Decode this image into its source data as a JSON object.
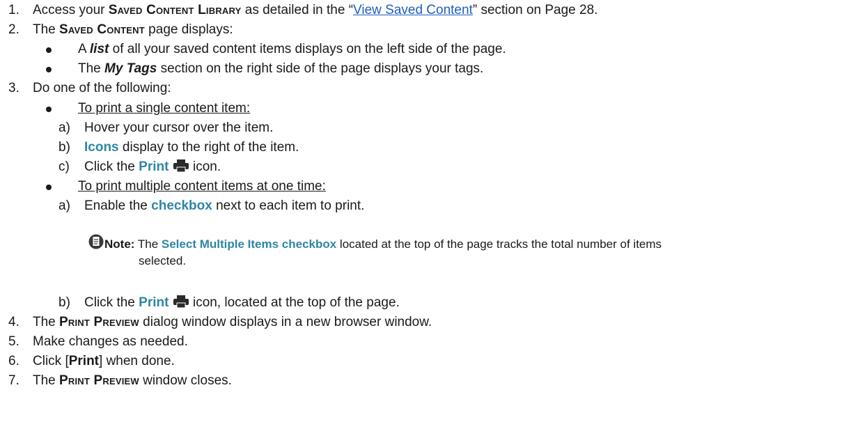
{
  "steps": [
    {
      "num": "1.",
      "pre": "Access your ",
      "term": "Saved Content Library",
      "mid": " as detailed in the “",
      "link": "View Saved Content",
      "post": "” section on Page 28."
    },
    {
      "num": "2.",
      "pre": "The ",
      "term": "Saved Content",
      "post": " page displays:"
    },
    {
      "num": "3.",
      "text": "Do one of the following:"
    },
    {
      "num": "4.",
      "pre": "The ",
      "term": "Print Preview",
      "post": " dialog window displays in a new browser window."
    },
    {
      "num": "5.",
      "text": "Make changes as needed."
    },
    {
      "num": "6.",
      "pre": "Click [",
      "bold": "Print",
      "post": "] when done."
    },
    {
      "num": "7.",
      "pre": "The ",
      "term": "Print Preview",
      "post": " window closes."
    }
  ],
  "step2_bullets": [
    {
      "pre": "A ",
      "em": "list",
      "post": " of all your saved content items displays on the left side of the page."
    },
    {
      "pre": "The ",
      "em": "My Tags",
      "post": " section on the right side of the page displays your tags."
    }
  ],
  "single": {
    "heading": "To print a single content item:",
    "a": {
      "label": "a)",
      "text": "Hover your cursor over the item."
    },
    "b": {
      "label": "b)",
      "em": "Icons",
      "post": " display to the right of the item."
    },
    "c": {
      "label": "c)",
      "pre": "Click the ",
      "em": "Print",
      "post": " icon."
    }
  },
  "multiple": {
    "heading": "To print multiple content items at one time:",
    "a": {
      "label": "a)",
      "pre": "Enable the ",
      "em": "checkbox",
      "post": " next to each item to print."
    },
    "note": {
      "label": "Note:",
      "pre": " The ",
      "em": "Select Multiple Items checkbox",
      "post": " located at the top of the page tracks the total number of items",
      "line2": "selected."
    },
    "b": {
      "label": "b)",
      "pre": "Click the ",
      "em": "Print",
      "post": " icon, located at the top of the page."
    }
  },
  "icons": {
    "print": "printer-icon",
    "note": "note-icon"
  },
  "colors": {
    "accent": "#2e86a6",
    "link": "#1f5fbf",
    "text": "#1a1a1a"
  }
}
